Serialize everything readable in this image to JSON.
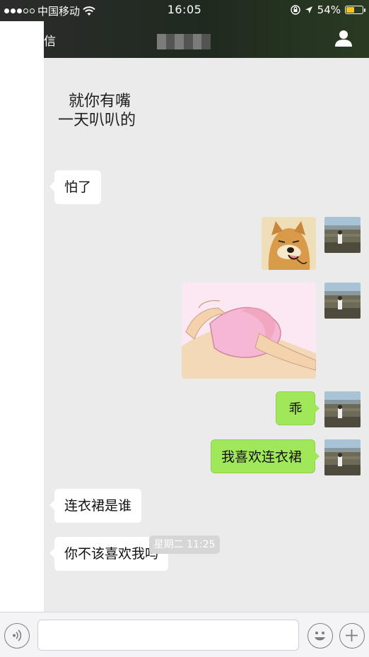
{
  "status_bar": {
    "carrier": "中国移动",
    "time": "16:05",
    "battery": "54%",
    "battery_level": 0.54
  },
  "nav": {
    "back_label": "信"
  },
  "messages": [
    {
      "side": "in",
      "kind": "text",
      "line1": "就你有嘴",
      "line2": "一天叭叭的"
    },
    {
      "side": "in",
      "kind": "text",
      "text": "怕了"
    },
    {
      "side": "out",
      "kind": "sticker",
      "icon": "shiba-dog-sticker"
    },
    {
      "side": "out",
      "kind": "image",
      "icon": "pink-cartoon-image"
    },
    {
      "side": "out",
      "kind": "text",
      "text": "乖"
    },
    {
      "side": "out",
      "kind": "text",
      "text": "我喜欢连衣裙"
    },
    {
      "side": "in",
      "kind": "text",
      "text": "连衣裙是谁"
    },
    {
      "side": "in",
      "kind": "text",
      "text": "你不该喜欢我吗"
    }
  ],
  "timestamp": "星期二 11:25",
  "colors": {
    "outgoing_bubble": "#a0e75a",
    "incoming_bubble": "#ffffff",
    "chat_background": "#ebebeb",
    "battery_fill": "#f5c518"
  },
  "input_bar": {
    "voice_icon": "voice-icon",
    "emoji_icon": "emoji-icon",
    "plus_icon": "plus-icon"
  }
}
